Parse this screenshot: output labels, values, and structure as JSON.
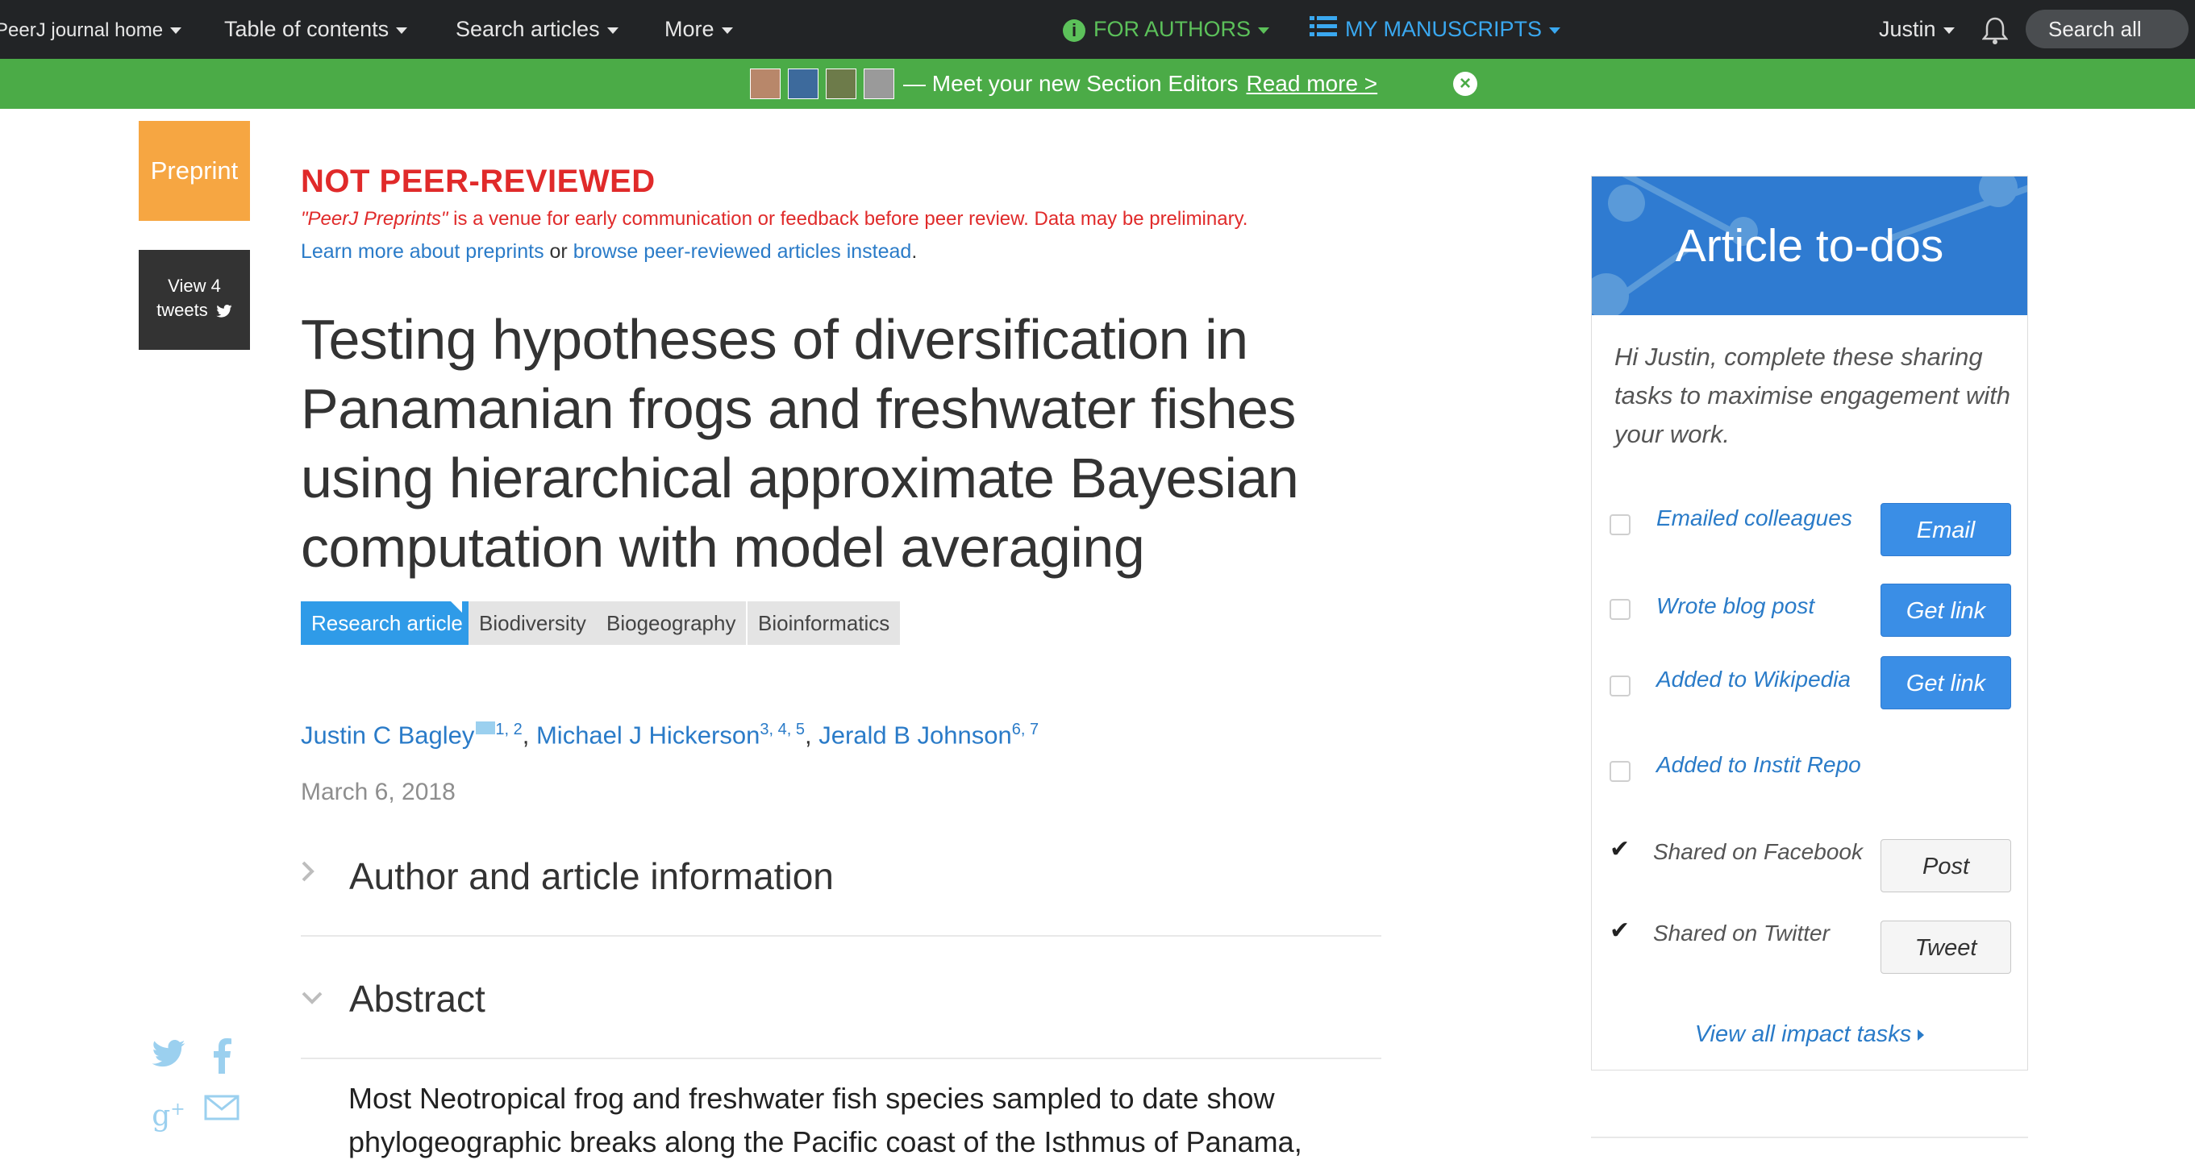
{
  "nav": {
    "journal_home": "PeerJ journal home",
    "toc": "Table of contents",
    "search_articles": "Search articles",
    "more": "More",
    "for_authors": "FOR AUTHORS",
    "my_manuscripts": "MY MANUSCRIPTS",
    "user": "Justin",
    "search_all": "Search all"
  },
  "banner": {
    "text": "— Meet your new Section Editors",
    "link": "Read more >"
  },
  "leftrail": {
    "badge": "Preprint",
    "tweets_line1": "View 4",
    "tweets_line2": "tweets"
  },
  "notice": {
    "heading": "NOT PEER-REVIEWED",
    "venue": "\"PeerJ Preprints\"",
    "disclaimer": " is a venue for early communication or feedback before peer review. Data may be preliminary.",
    "learn_more": "Learn more about preprints",
    "or": " or ",
    "browse": "browse peer-reviewed articles instead",
    "period": "."
  },
  "article": {
    "title": "Testing hypotheses of diversification in Panamanian frogs and freshwater fishes using hierarchical approximate Bayesian computation with model averaging",
    "tags": [
      "Research article",
      "Biodiversity",
      "Biogeography",
      "Bioinformatics"
    ],
    "authors": [
      {
        "name": "Justin C Bagley",
        "sup": "1, 2"
      },
      {
        "name": "Michael J Hickerson",
        "sup": "3, 4, 5"
      },
      {
        "name": "Jerald B Johnson",
        "sup": "6, 7"
      }
    ],
    "date": "March 6, 2018",
    "sections": [
      "Author and article information",
      "Abstract"
    ],
    "abstract": "Most Neotropical frog and freshwater fish species sampled to date show phylogeographic breaks along the Pacific coast of the Isthmus of Panama,"
  },
  "todos": {
    "title": "Article to-dos",
    "intro": "Hi Justin, complete these sharing tasks to maximise engagement with your work.",
    "items": [
      {
        "label": "Emailed colleagues",
        "button": "Email",
        "done": false
      },
      {
        "label": "Wrote blog post",
        "button": "Get link",
        "done": false
      },
      {
        "label": "Added to Wikipedia",
        "button": "Get link",
        "done": false
      },
      {
        "label": "Added to Instit Repo",
        "button": "",
        "done": false
      },
      {
        "label": "Shared on Facebook",
        "button": "Post",
        "done": true
      },
      {
        "label": "Shared on Twitter",
        "button": "Tweet",
        "done": true
      }
    ],
    "view_all": "View all impact tasks"
  },
  "colors": {
    "nav_bg": "#222426",
    "banner_green": "#4bab47",
    "alert_red": "#e02a2a",
    "link_blue": "#2a7bc8",
    "todo_header_blue": "#2f7bd1",
    "preprint_orange": "#f6a642"
  }
}
